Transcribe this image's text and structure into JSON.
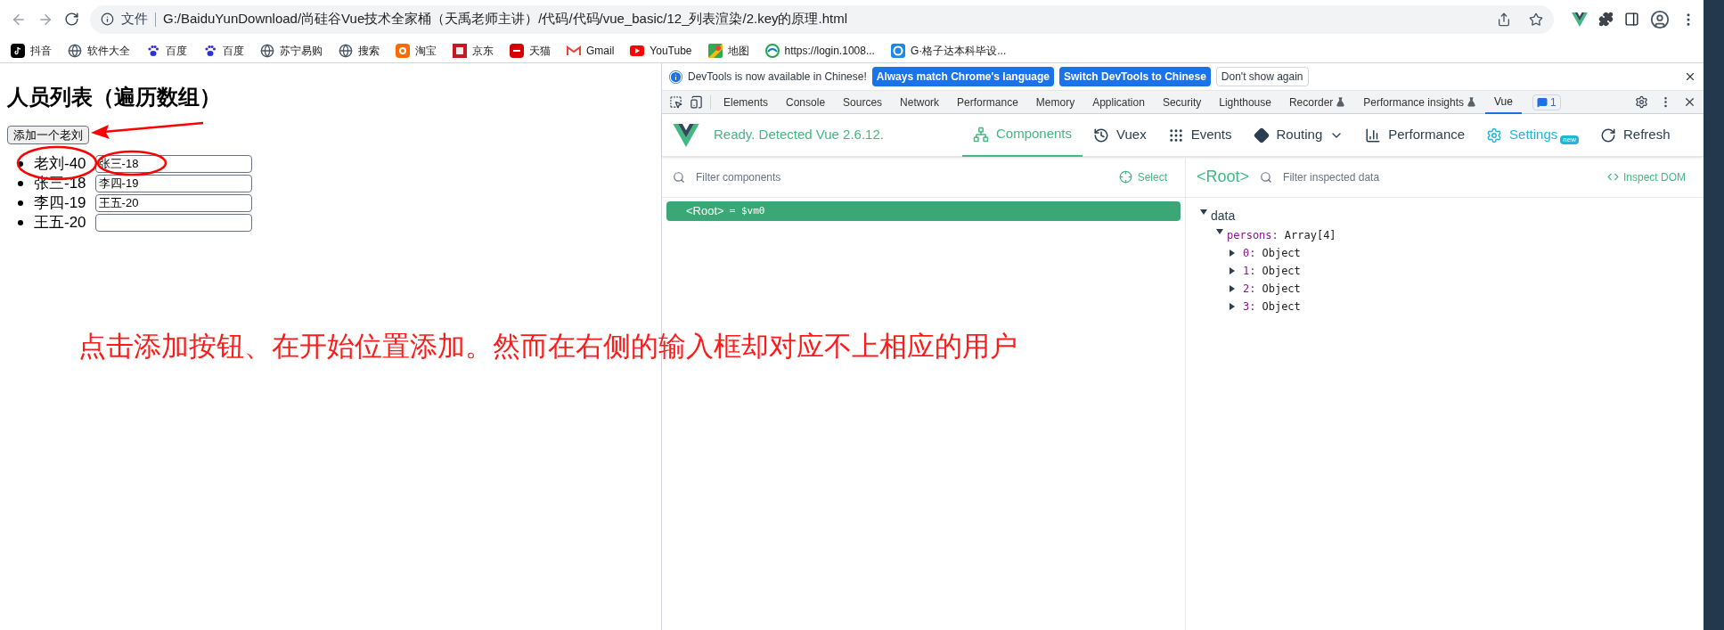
{
  "browser": {
    "address": {
      "label": "文件",
      "url": "G:/BaiduYunDownload/尚硅谷Vue技术全家桶（天禹老师主讲）/代码/代码/vue_basic/12_列表渲染/2.key的原理.html"
    },
    "bookmarks": [
      {
        "label": "抖音",
        "kind": "tiktok"
      },
      {
        "label": "软件大全",
        "kind": "globe"
      },
      {
        "label": "百度",
        "kind": "paw"
      },
      {
        "label": "百度",
        "kind": "paw"
      },
      {
        "label": "苏宁易购",
        "kind": "globe"
      },
      {
        "label": "搜索",
        "kind": "globe"
      },
      {
        "label": "淘宝",
        "kind": "tao"
      },
      {
        "label": "京东",
        "kind": "jd"
      },
      {
        "label": "天猫",
        "kind": "tmall"
      },
      {
        "label": "Gmail",
        "kind": "gmail"
      },
      {
        "label": "YouTube",
        "kind": "youtube"
      },
      {
        "label": "地图",
        "kind": "maps"
      },
      {
        "label": "https://login.1008...",
        "kind": "swirl"
      },
      {
        "label": "G·格子达本科毕设...",
        "kind": "g"
      }
    ]
  },
  "page": {
    "heading": "人员列表（遍历数组）",
    "add_button": "添加一个老刘",
    "persons": [
      {
        "label": "老刘-40",
        "value": "张三-18"
      },
      {
        "label": "张三-18",
        "value": "李四-19"
      },
      {
        "label": "李四-19",
        "value": "王五-20"
      },
      {
        "label": "王五-20"
      }
    ],
    "annotation": "点击添加按钮、在开始位置添加。然而在右侧的输入框却对应不上相应的用户"
  },
  "devtools": {
    "infobar": {
      "message": "DevTools is now available in Chinese!",
      "buttons": [
        {
          "label": "Always match Chrome's language",
          "primary": true
        },
        {
          "label": "Switch DevTools to Chinese",
          "primary": true
        },
        {
          "label": "Don't show again",
          "primary": false
        }
      ]
    },
    "tabs": [
      {
        "label": "Elements",
        "selected": false,
        "experimental": false
      },
      {
        "label": "Console",
        "selected": false,
        "experimental": false
      },
      {
        "label": "Sources",
        "selected": false,
        "experimental": false
      },
      {
        "label": "Network",
        "selected": false,
        "experimental": false
      },
      {
        "label": "Performance",
        "selected": false,
        "experimental": false
      },
      {
        "label": "Memory",
        "selected": false,
        "experimental": false
      },
      {
        "label": "Application",
        "selected": false,
        "experimental": false
      },
      {
        "label": "Security",
        "selected": false,
        "experimental": false
      },
      {
        "label": "Lighthouse",
        "selected": false,
        "experimental": false
      },
      {
        "label": "Recorder",
        "selected": false,
        "experimental": true
      },
      {
        "label": "Performance insights",
        "selected": false,
        "experimental": true
      },
      {
        "label": "Vue",
        "selected": true,
        "experimental": false
      }
    ],
    "issues_count": "1",
    "vue": {
      "status": "Ready. Detected Vue 2.6.12.",
      "nav": [
        {
          "label": "Components",
          "kind": "components",
          "selected": true
        },
        {
          "label": "Vuex",
          "kind": "vuex",
          "selected": false
        },
        {
          "label": "Events",
          "kind": "events",
          "selected": false
        },
        {
          "label": "Routing",
          "kind": "routing",
          "selected": false
        },
        {
          "label": "Performance",
          "kind": "performance",
          "selected": false
        },
        {
          "label": "Settings",
          "kind": "settings",
          "selected": false,
          "badge": "new"
        },
        {
          "label": "Refresh",
          "kind": "refresh",
          "selected": false
        }
      ],
      "filter_placeholder": "Filter components",
      "select": "Select",
      "tree": [
        {
          "name": "<Root>",
          "ref": "= $vm0",
          "selected": true
        }
      ],
      "inspector": {
        "title": "<Root>",
        "filter_placeholder": "Filter inspected data",
        "inspect_dom": "Inspect DOM",
        "sections": [
          {
            "name": "data",
            "expanded": true,
            "children": [
              {
                "key": "persons:",
                "value": "Array[4]",
                "expanded": true,
                "children": [
                  {
                    "key": "0:",
                    "value": "Object",
                    "expanded": false
                  },
                  {
                    "key": "1:",
                    "value": "Object",
                    "expanded": false
                  },
                  {
                    "key": "2:",
                    "value": "Object",
                    "expanded": false
                  },
                  {
                    "key": "3:",
                    "value": "Object",
                    "expanded": false
                  }
                ]
              }
            ]
          }
        ]
      }
    }
  }
}
